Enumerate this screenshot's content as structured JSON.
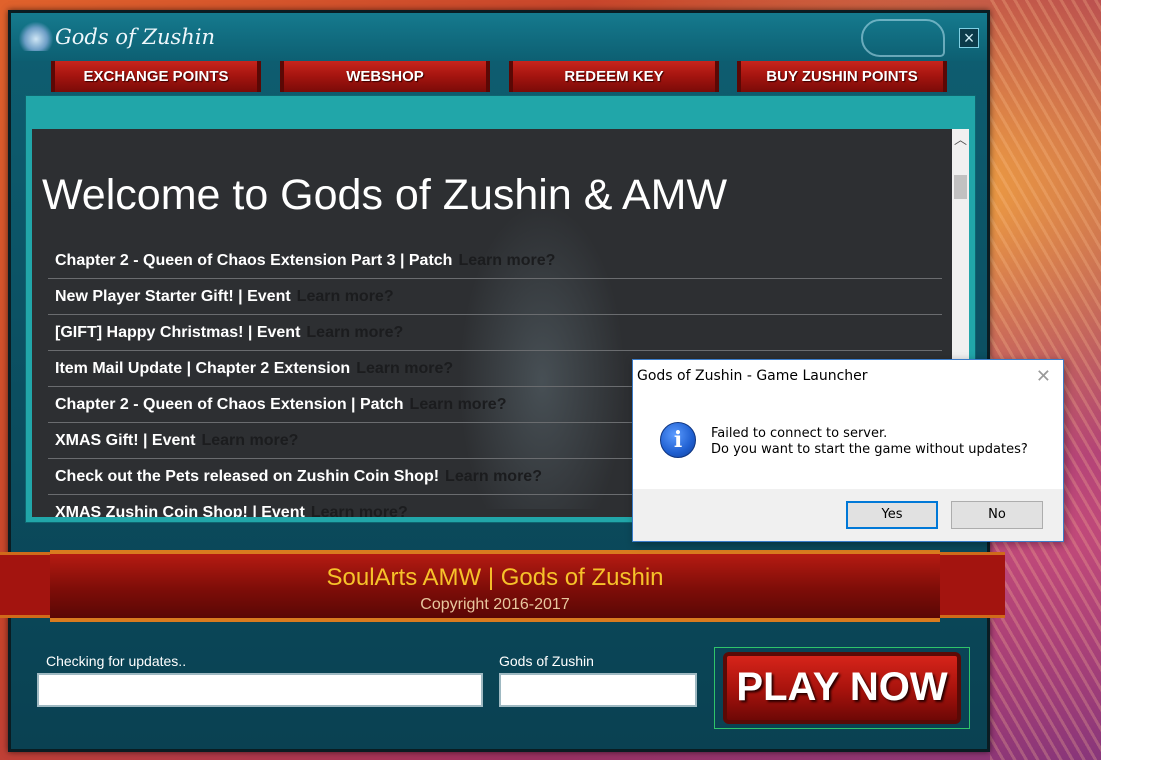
{
  "launcher": {
    "title": "Gods of Zushin",
    "close_glyph": "×"
  },
  "nav": [
    {
      "label": "EXCHANGE POINTS"
    },
    {
      "label": "WEBSHOP"
    },
    {
      "label": "REDEEM KEY"
    },
    {
      "label": "BUY ZUSHIN POINTS"
    }
  ],
  "news": {
    "welcome": "Welcome to Gods of Zushin & AMW",
    "learn_more": "Learn more?",
    "items": [
      {
        "title": "Chapter 2 - Queen of Chaos Extension Part 3 | Patch"
      },
      {
        "title": "New Player Starter Gift! | Event"
      },
      {
        "title": "[GIFT] Happy Christmas! | Event"
      },
      {
        "title": "Item Mail Update | Chapter 2 Extension"
      },
      {
        "title": "Chapter 2 - Queen of Chaos Extension | Patch"
      },
      {
        "title": "XMAS Gift! | Event"
      },
      {
        "title": "Check out the Pets released on Zushin Coin Shop!"
      },
      {
        "title": "XMAS Zushin Coin Shop! | Event"
      }
    ],
    "scroll_up_glyph": "︿"
  },
  "banner": {
    "title": "SoulArts AMW | Gods of Zushin",
    "copyright": "Copyright 2016-2017"
  },
  "status": {
    "update_label": "Checking for updates..",
    "game_label": "Gods of Zushin"
  },
  "play_button": "PLAY NOW",
  "dialog": {
    "title": "Gods of Zushin - Game Launcher",
    "close_glyph": "✕",
    "icon_glyph": "i",
    "message_line1": "Failed to connect to server.",
    "message_line2": "Do you want to start the game without updates?",
    "yes": "Yes",
    "no": "No"
  }
}
